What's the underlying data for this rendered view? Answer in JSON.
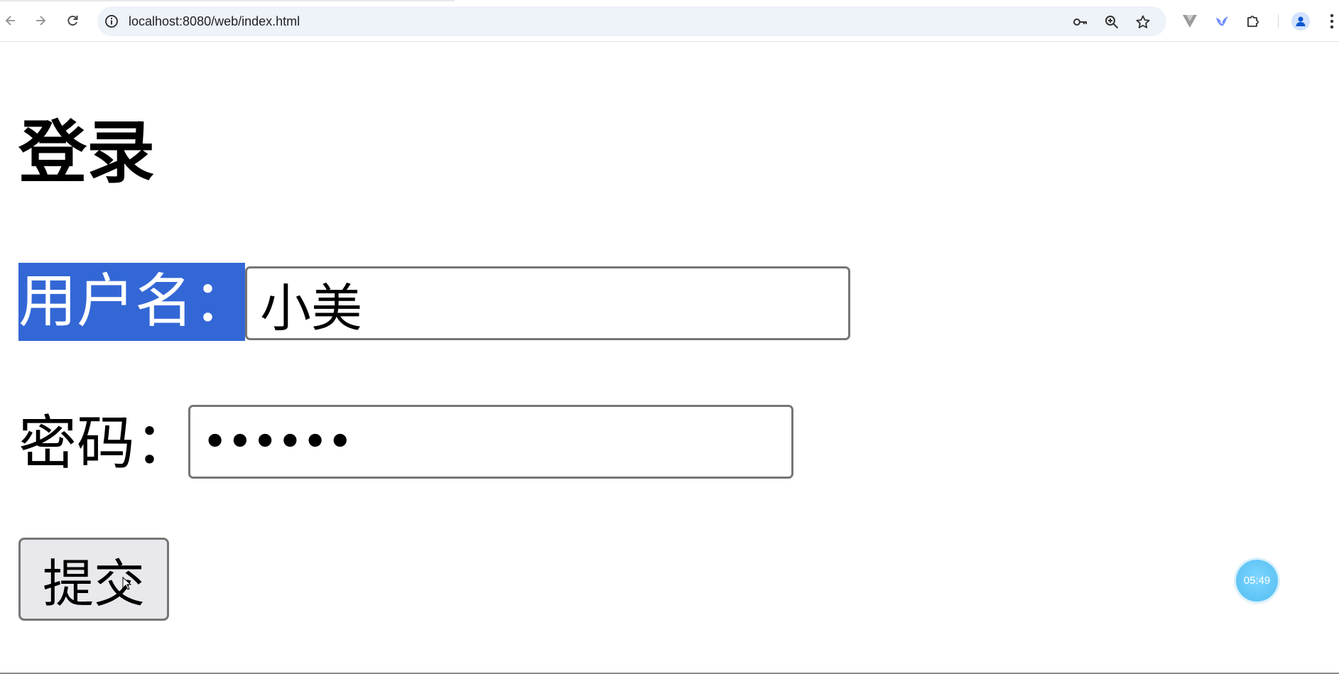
{
  "browser": {
    "url": "localhost:8080/web/index.html"
  },
  "page": {
    "title": "登录",
    "username_label": "用户名：",
    "username_value": "小美",
    "password_label": "密码：",
    "password_value": "••••••",
    "submit_label": "提交"
  },
  "overlay": {
    "timer": "05:49"
  },
  "icons": {
    "back": "arrow-left-icon",
    "forward": "arrow-right-icon",
    "reload": "reload-icon",
    "site_info": "info-icon",
    "password_manager": "key-icon",
    "zoom": "zoom-in-icon",
    "bookmark": "star-icon",
    "extension_v": "vue-devtools-icon",
    "extension_bird": "bird-icon",
    "extensions": "puzzle-icon",
    "profile": "person-icon",
    "menu": "more-vert-icon"
  },
  "colors": {
    "selection_highlight": "#3367d6",
    "omnibox_bg": "#eef2f9",
    "input_border": "#767676",
    "button_bg": "#e9e9ed",
    "timer_bg": "#5ec4f5"
  }
}
